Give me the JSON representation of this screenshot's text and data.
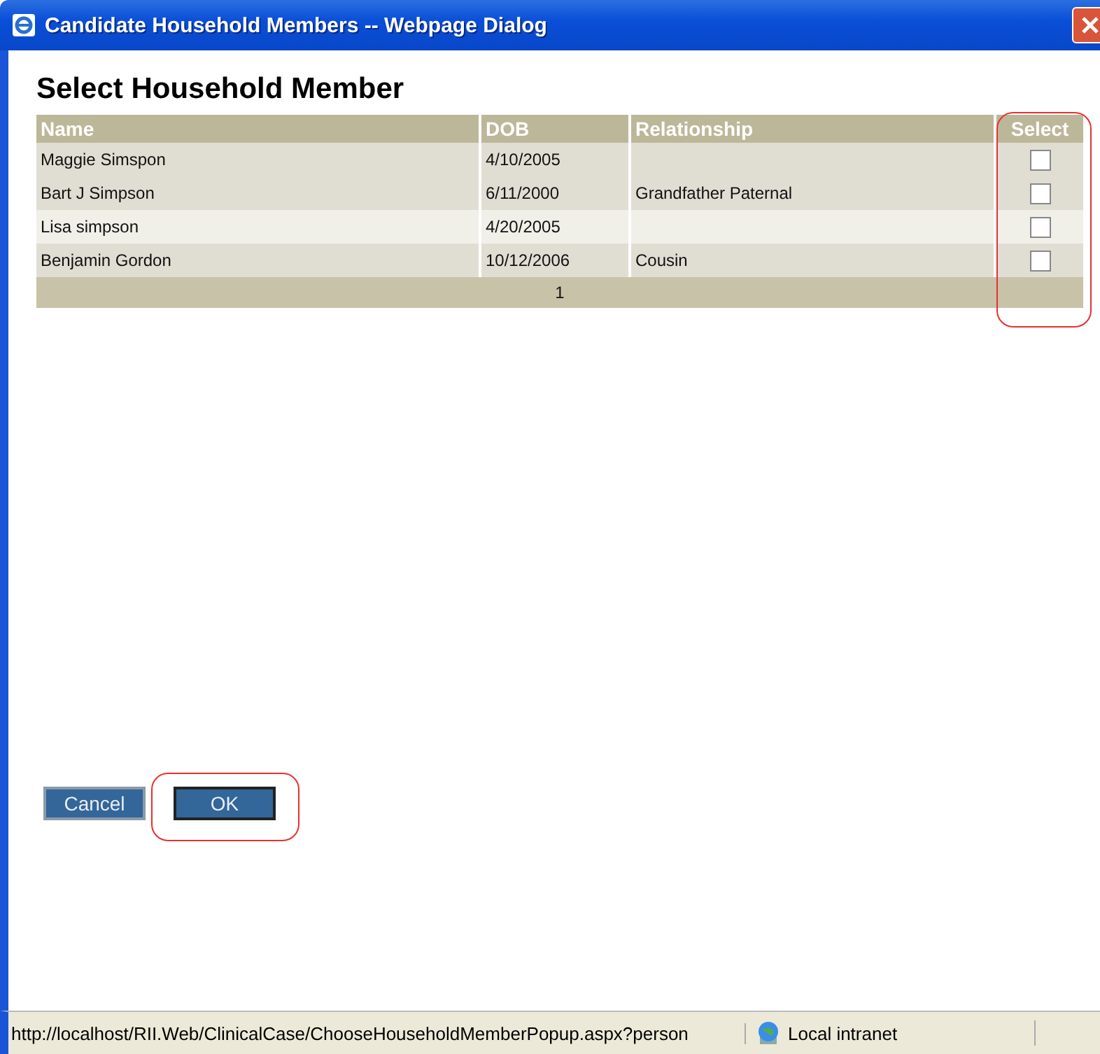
{
  "window": {
    "title": "Candidate Household Members -- Webpage Dialog"
  },
  "heading": "Select Household Member",
  "table": {
    "columns": [
      "Name",
      "DOB",
      "Relationship",
      "Select"
    ],
    "rows": [
      {
        "name": "Maggie Simspon",
        "dob": "4/10/2005",
        "relationship": "",
        "checked": false,
        "highlighted": false
      },
      {
        "name": "Bart J Simpson",
        "dob": "6/11/2000",
        "relationship": "Grandfather Paternal",
        "checked": false,
        "highlighted": false
      },
      {
        "name": "Lisa simpson",
        "dob": "4/20/2005",
        "relationship": "",
        "checked": false,
        "highlighted": true
      },
      {
        "name": "Benjamin Gordon",
        "dob": "10/12/2006",
        "relationship": "Cousin",
        "checked": false,
        "highlighted": false
      }
    ],
    "pager": "1"
  },
  "buttons": [
    {
      "label": "Cancel",
      "focused": false
    },
    {
      "label": "OK",
      "focused": true
    }
  ],
  "status_bar": {
    "url": "http://localhost/RII.Web/ClinicalCase/ChooseHouseholdMemberPopup.aspx?person",
    "zone": "Local intranet"
  }
}
